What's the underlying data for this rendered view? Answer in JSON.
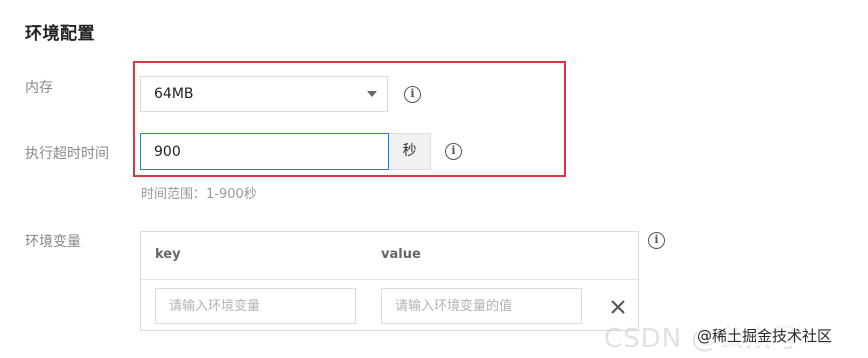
{
  "section": {
    "title": "环境配置"
  },
  "memory": {
    "label": "内存",
    "value": "64MB"
  },
  "timeout": {
    "label": "执行超时时间",
    "value": "900",
    "unit": "秒",
    "hint": "时间范围：1-900秒"
  },
  "env": {
    "label": "环境变量",
    "key_header": "key",
    "value_header": "value",
    "key_placeholder": "请输入环境变量",
    "value_placeholder": "请输入环境变量的值"
  },
  "icons": {
    "info": "info-icon",
    "remove": "close-icon",
    "dropdown": "chevron-down-icon"
  },
  "colors": {
    "highlight": "#d9363e",
    "focus_border": "#1f7fd6"
  },
  "watermark": {
    "text": "CSDN @公众号",
    "credit": "@稀土掘金技术社区"
  }
}
